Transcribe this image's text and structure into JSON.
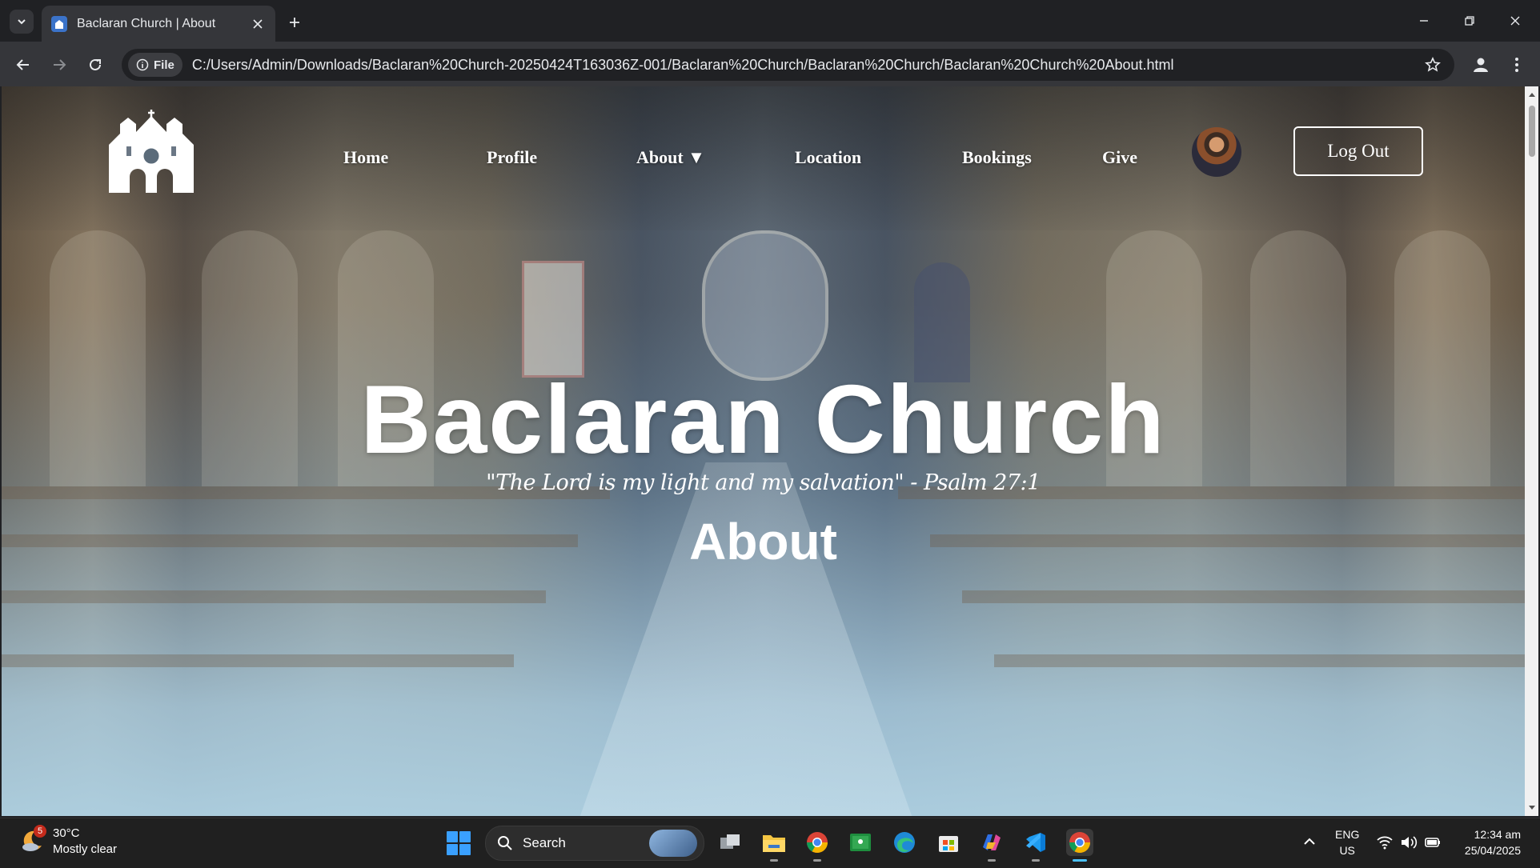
{
  "browser": {
    "tab_title": "Baclaran Church | About",
    "chip_label": "File",
    "url": "C:/Users/Admin/Downloads/Baclaran%20Church-20250424T163036Z-001/Baclaran%20Church/Baclaran%20Church/Baclaran%20Church%20About.html"
  },
  "nav": {
    "items": [
      {
        "label": "Home"
      },
      {
        "label": "Profile"
      },
      {
        "label": "About ▼"
      },
      {
        "label": "Location"
      },
      {
        "label": "Bookings"
      },
      {
        "label": "Give"
      }
    ],
    "logout_label": "Log Out"
  },
  "hero": {
    "title": "Baclaran Church",
    "quote": "\"The Lord is my light and my salvation\" - Psalm 27:1",
    "subtitle": "About"
  },
  "taskbar": {
    "weather_badge": "5",
    "temperature": "30°C",
    "weather": "Mostly clear",
    "search_label": "Search",
    "lang_top": "ENG",
    "lang_bottom": "US",
    "time": "12:34 am",
    "date": "25/04/2025",
    "accent": "#4cc2ff"
  },
  "icons": [
    "tab-search-icon",
    "church-favicon-icon",
    "close-icon",
    "plus-icon",
    "minimize-icon",
    "restore-icon",
    "window-close-icon",
    "back-icon",
    "forward-icon",
    "reload-icon",
    "info-icon",
    "star-icon",
    "profile-icon",
    "menu-icon",
    "church-logo-icon",
    "windows-start-icon",
    "search-icon",
    "file-explorer-icon",
    "chrome-icon",
    "edge-icon",
    "store-icon",
    "vscode-icon",
    "wifi-icon",
    "volume-icon",
    "battery-icon"
  ]
}
